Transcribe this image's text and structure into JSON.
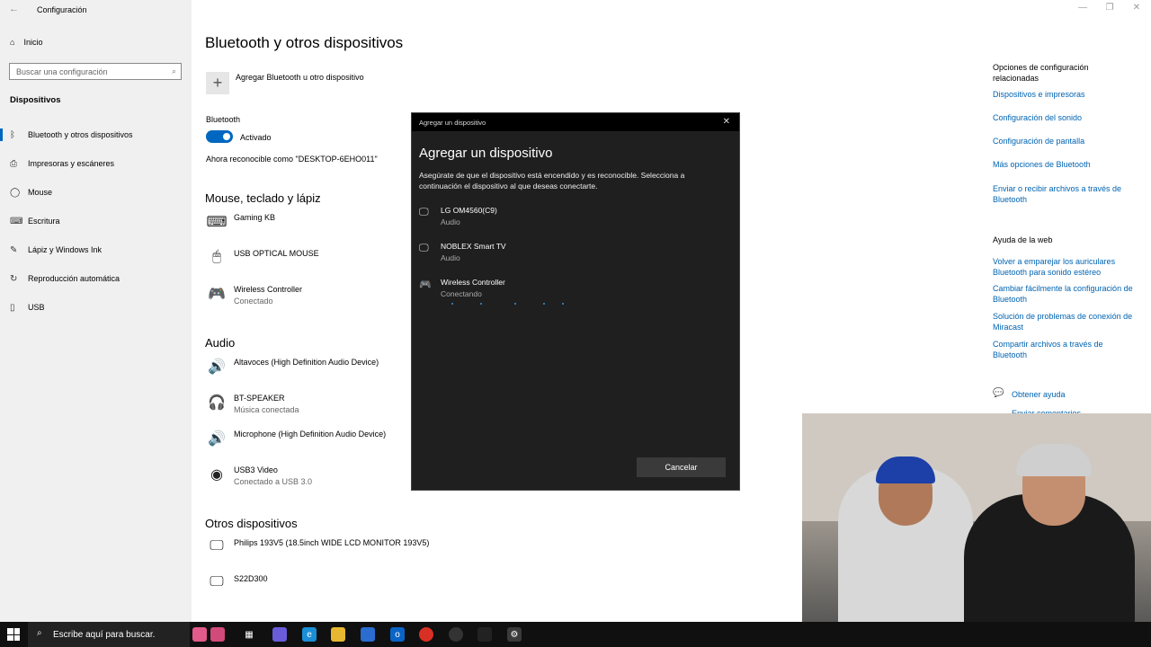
{
  "window": {
    "title": "Configuración",
    "back": "←",
    "min": "—",
    "max": "❐",
    "close": "✕"
  },
  "sidebar": {
    "home": {
      "icon": "⌂",
      "label": "Inicio"
    },
    "search_placeholder": "Buscar una configuración",
    "section_title": "Dispositivos",
    "items": [
      {
        "icon": "ᛒ",
        "label": "Bluetooth y otros dispositivos",
        "active": true
      },
      {
        "icon": "⎙",
        "label": "Impresoras y escáneres"
      },
      {
        "icon": "◯",
        "label": "Mouse"
      },
      {
        "icon": "⌨",
        "label": "Escritura"
      },
      {
        "icon": "✎",
        "label": "Lápiz y Windows Ink"
      },
      {
        "icon": "↻",
        "label": "Reproducción automática"
      },
      {
        "icon": "▯",
        "label": "USB"
      }
    ]
  },
  "main": {
    "title": "Bluetooth y otros dispositivos",
    "add_label": "Agregar Bluetooth u otro dispositivo",
    "bluetooth_label": "Bluetooth",
    "toggle_state": "Activado",
    "discoverable": "Ahora reconocible como \"DESKTOP-6EHO011\"",
    "groups": {
      "mouse": {
        "title": "Mouse, teclado y lápiz",
        "devices": [
          {
            "icon": "⌨",
            "name": "Gaming KB",
            "status": ""
          },
          {
            "icon": "🖱",
            "name": "USB OPTICAL MOUSE",
            "status": ""
          },
          {
            "icon": "🎮",
            "name": "Wireless Controller",
            "status": "Conectado"
          }
        ]
      },
      "audio": {
        "title": "Audio",
        "devices": [
          {
            "icon": "🔊",
            "name": "Altavoces (High Definition Audio Device)",
            "status": ""
          },
          {
            "icon": "🎧",
            "name": "BT-SPEAKER",
            "status": "Música conectada"
          },
          {
            "icon": "🔊",
            "name": "Microphone (High Definition Audio Device)",
            "status": ""
          },
          {
            "icon": "◉",
            "name": "USB3 Video",
            "status": "Conectado a USB 3.0"
          }
        ]
      },
      "other": {
        "title": "Otros dispositivos",
        "devices": [
          {
            "icon": "🖵",
            "name": "Philips 193V5 (18.5inch WIDE LCD MONITOR 193V5)",
            "status": ""
          },
          {
            "icon": "🖵",
            "name": "S22D300",
            "status": ""
          }
        ]
      }
    }
  },
  "right": {
    "related_title": "Opciones de configuración relacionadas",
    "related_links": [
      "Dispositivos e impresoras",
      "Configuración del sonido",
      "Configuración de pantalla",
      "Más opciones de Bluetooth",
      "Enviar o recibir archivos a través de Bluetooth"
    ],
    "help_title": "Ayuda de la web",
    "help_links": [
      "Volver a emparejar los auriculares Bluetooth para sonido estéreo",
      "Cambiar fácilmente la configuración de Bluetooth",
      "Solución de problemas de conexión de Miracast",
      "Compartir archivos a través de Bluetooth"
    ],
    "get_help": "Obtener ayuda",
    "feedback": "Enviar comentarios"
  },
  "dialog": {
    "bar_title": "Agregar un dispositivo",
    "heading": "Agregar un dispositivo",
    "description": "Asegúrate de que el dispositivo está encendido y es reconocible. Selecciona a continuación el dispositivo al que deseas conectarte.",
    "devices": [
      {
        "icon": "🖵",
        "name": "LG OM4560(C9)",
        "status": "Audio"
      },
      {
        "icon": "🖵",
        "name": "NOBLEX Smart TV",
        "status": "Audio"
      },
      {
        "icon": "🎮",
        "name": "Wireless Controller",
        "status": "Conectando"
      }
    ],
    "cancel": "Cancelar"
  },
  "taskbar": {
    "search_placeholder": "Escribe aquí para buscar."
  },
  "colors": {
    "accent": "#0067c0",
    "link": "#0063b1",
    "dialog_bg": "#1f1f1f"
  }
}
